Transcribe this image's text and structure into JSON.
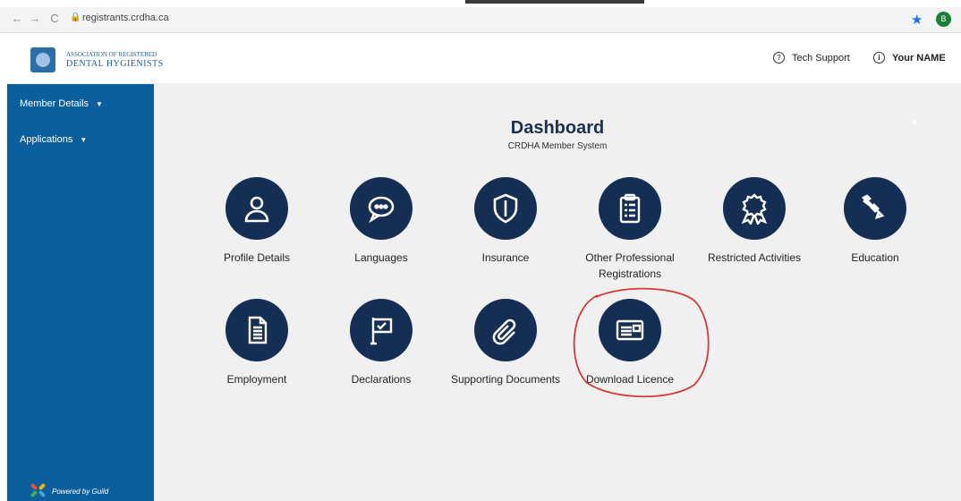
{
  "browser": {
    "url": "registrants.crdha.ca"
  },
  "header": {
    "logo_line1": "ASSOCIATION OF REGISTERED",
    "logo_line2": "DENTAL HYGIENISTS",
    "tech_support": "Tech Support",
    "user_name": "Your NAME",
    "avatar_initial": "B"
  },
  "sidebar": {
    "items": [
      {
        "label": "Member Details"
      },
      {
        "label": "Applications"
      }
    ],
    "powered_by": "Powered by Guild"
  },
  "main": {
    "title": "Dashboard",
    "subtitle": "CRDHA Member System",
    "tiles": [
      {
        "label": "Profile Details",
        "icon": "profile-icon"
      },
      {
        "label": "Languages",
        "icon": "speech-bubble-icon"
      },
      {
        "label": "Insurance",
        "icon": "shield-icon"
      },
      {
        "label": "Other Professional Registrations",
        "icon": "clipboard-icon"
      },
      {
        "label": "Restricted Activities",
        "icon": "award-ribbon-icon"
      },
      {
        "label": "Education",
        "icon": "pencil-icon"
      },
      {
        "label": "Employment",
        "icon": "document-icon"
      },
      {
        "label": "Declarations",
        "icon": "flag-icon"
      },
      {
        "label": "Supporting Documents",
        "icon": "paperclip-icon"
      },
      {
        "label": "Download Licence",
        "icon": "id-card-icon"
      }
    ]
  },
  "colors": {
    "sidebar": "#0a5f9c",
    "tile_circle": "#142e54",
    "annotation": "#d23a3a"
  }
}
